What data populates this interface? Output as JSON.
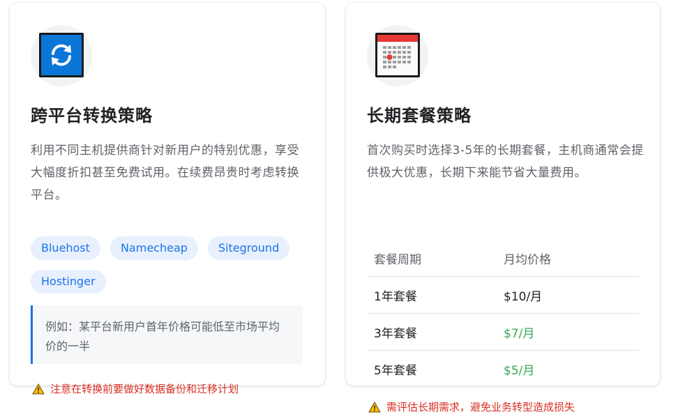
{
  "left_card": {
    "title": "跨平台转换策略",
    "description": "利用不同主机提供商针对新用户的特别优惠，享受大幅度折扣甚至免费试用。在续费昂贵时考虑转换平台。",
    "tags": [
      "Bluehost",
      "Namecheap",
      "Siteground",
      "Hostinger"
    ],
    "example": "例如：某平台新用户首年价格可能低至市场平均价的一半",
    "warning": "注意在转换前要做好数据备份和迁移计划",
    "icon": "sync-icon"
  },
  "right_card": {
    "title": "长期套餐策略",
    "description": "首次购买时选择3-5年的长期套餐，主机商通常会提供极大优惠，长期下来能节省大量费用。",
    "table": {
      "headers": [
        "套餐周期",
        "月均价格"
      ],
      "rows": [
        {
          "period": "1年套餐",
          "price": "$10/月"
        },
        {
          "period": "3年套餐",
          "price": "$7/月"
        },
        {
          "period": "5年套餐",
          "price": "$5/月"
        }
      ]
    },
    "warning": "需评估长期需求，避免业务转型造成损失",
    "icon": "calendar-icon"
  },
  "colors": {
    "accent": "#1a73e8",
    "warning": "#d93025",
    "good_price": "#34a853",
    "tag_bg": "#e8f0fe"
  }
}
